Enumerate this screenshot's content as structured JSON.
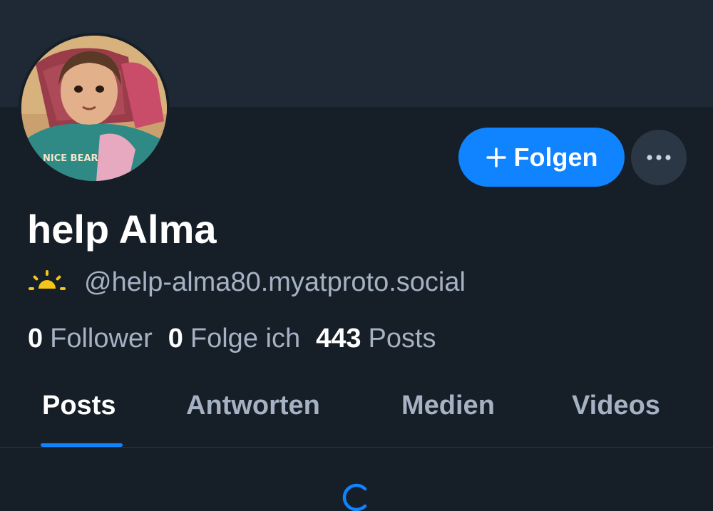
{
  "profile": {
    "display_name": "help Alma",
    "handle": "@help-alma80.myatproto.social",
    "handle_icon": "sun-icon",
    "avatar_icon": "profile-photo"
  },
  "actions": {
    "follow_label": "Folgen",
    "follow_icon": "plus-icon",
    "more_icon": "ellipsis-icon"
  },
  "stats": {
    "followers_count": "0",
    "followers_label": "Follower",
    "following_count": "0",
    "following_label": "Folge ich",
    "posts_count": "443",
    "posts_label": "Posts"
  },
  "tabs": [
    {
      "label": "Posts",
      "active": true
    },
    {
      "label": "Antworten",
      "active": false
    },
    {
      "label": "Medien",
      "active": false
    },
    {
      "label": "Videos",
      "active": false
    }
  ],
  "colors": {
    "background": "#161e27",
    "banner": "#1e2935",
    "accent": "#1083fe",
    "muted_text": "#a5b2c3",
    "sun": "#f5c518"
  },
  "feed": {
    "loading_icon": "loading-spinner-icon"
  }
}
